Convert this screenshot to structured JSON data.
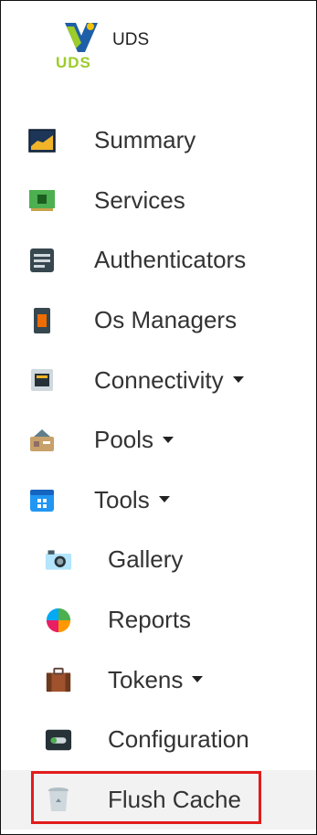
{
  "brand": {
    "label": "UDS",
    "logo_text": "UDS",
    "logo_icon": "uds-logo-icon"
  },
  "nav": {
    "items": [
      {
        "label": "Summary",
        "icon": "summary-icon",
        "level": 1,
        "has_submenu": false
      },
      {
        "label": "Services",
        "icon": "services-icon",
        "level": 1,
        "has_submenu": false
      },
      {
        "label": "Authenticators",
        "icon": "authenticators-icon",
        "level": 1,
        "has_submenu": false
      },
      {
        "label": "Os Managers",
        "icon": "os-managers-icon",
        "level": 1,
        "has_submenu": false
      },
      {
        "label": "Connectivity",
        "icon": "connectivity-icon",
        "level": 1,
        "has_submenu": true
      },
      {
        "label": "Pools",
        "icon": "pools-icon",
        "level": 1,
        "has_submenu": true
      },
      {
        "label": "Tools",
        "icon": "tools-icon",
        "level": 1,
        "has_submenu": true
      },
      {
        "label": "Gallery",
        "icon": "gallery-icon",
        "level": 2,
        "has_submenu": false
      },
      {
        "label": "Reports",
        "icon": "reports-icon",
        "level": 2,
        "has_submenu": false
      },
      {
        "label": "Tokens",
        "icon": "tokens-icon",
        "level": 2,
        "has_submenu": true
      },
      {
        "label": "Configuration",
        "icon": "configuration-icon",
        "level": 2,
        "has_submenu": false
      },
      {
        "label": "Flush Cache",
        "icon": "trash-icon",
        "level": 2,
        "has_submenu": false,
        "highlighted": true
      }
    ]
  },
  "colors": {
    "highlight_border": "#e21b1b",
    "text": "#333333",
    "logo_green": "#9ccc2a",
    "logo_blue": "#1f5fa8"
  }
}
